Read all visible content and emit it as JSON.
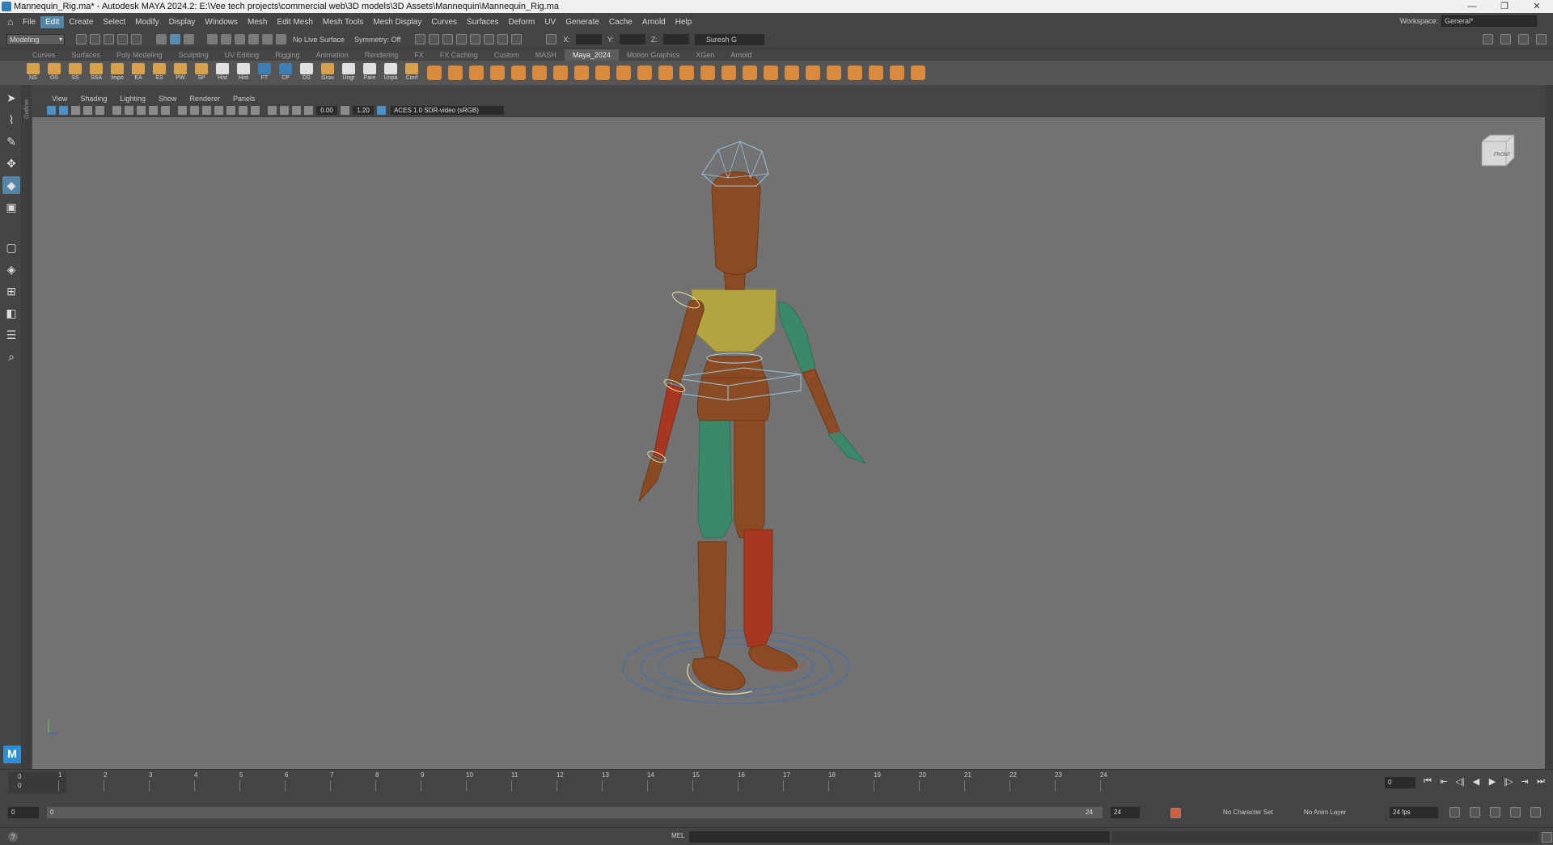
{
  "title": "Mannequin_Rig.ma* - Autodesk MAYA 2024.2: E:\\Vee tech projects\\commercial web\\3D models\\3D Assets\\Mannequin\\Mannequin_Rig.ma",
  "menus": [
    "File",
    "Edit",
    "Create",
    "Select",
    "Modify",
    "Display",
    "Windows",
    "Mesh",
    "Edit Mesh",
    "Mesh Tools",
    "Mesh Display",
    "Curves",
    "Surfaces",
    "Deform",
    "UV",
    "Generate",
    "Cache",
    "Arnold",
    "Help"
  ],
  "active_menu": "Edit",
  "workspace": {
    "label": "Workspace:",
    "value": "General*"
  },
  "statusline": {
    "mode": "Modeling",
    "live_surface": "No Live Surface",
    "symmetry": "Symmetry: Off",
    "x_label": "X:",
    "y_label": "Y:",
    "z_label": "Z:",
    "user": "Suresh G"
  },
  "shelf_tabs": [
    "Curves",
    "Surfaces",
    "Poly Modeling",
    "Sculpting",
    "UV Editing",
    "Rigging",
    "Animation",
    "Rendering",
    "FX",
    "FX Caching",
    "Custom",
    "MASH",
    "Maya_2024",
    "Motion Graphics",
    "XGen",
    "Arnold"
  ],
  "active_shelf_tab": "Maya_2024",
  "shelf_buttons": [
    "NS",
    "OS",
    "SS",
    "SSA",
    "Impo",
    "EA",
    "ES",
    "PW",
    "SP",
    "Hist",
    "Hist",
    "FT",
    "CP",
    "DS",
    "Grou",
    "Ungr",
    "Pare",
    "Unpa",
    "Conf"
  ],
  "outliner_label": "Outliner",
  "panel_menus": [
    "View",
    "Shading",
    "Lighting",
    "Show",
    "Renderer",
    "Panels"
  ],
  "panel_toolbar": {
    "exposure": "0.00",
    "gamma": "1.20",
    "color_mgmt": "ACES 1.0 SDR-video (sRGB)"
  },
  "viewcube_label": "FRONT",
  "timeline": {
    "frames": [
      "1",
      "2",
      "3",
      "4",
      "5",
      "6",
      "7",
      "8",
      "9",
      "10",
      "11",
      "12",
      "13",
      "14",
      "15",
      "16",
      "17",
      "18",
      "19",
      "20",
      "21",
      "22",
      "23",
      "24"
    ],
    "left_top": "0",
    "left_bottom": "0",
    "current_frame": "0"
  },
  "range": {
    "start": "0",
    "inner_start": "0",
    "inner_end": "24",
    "end": "24",
    "character_set": "No Character Set",
    "anim_layer": "No Anim Layer",
    "fps": "24 fps"
  },
  "cmdline": {
    "lang": "MEL"
  },
  "window_buttons": [
    "—",
    "❐",
    "✕"
  ]
}
